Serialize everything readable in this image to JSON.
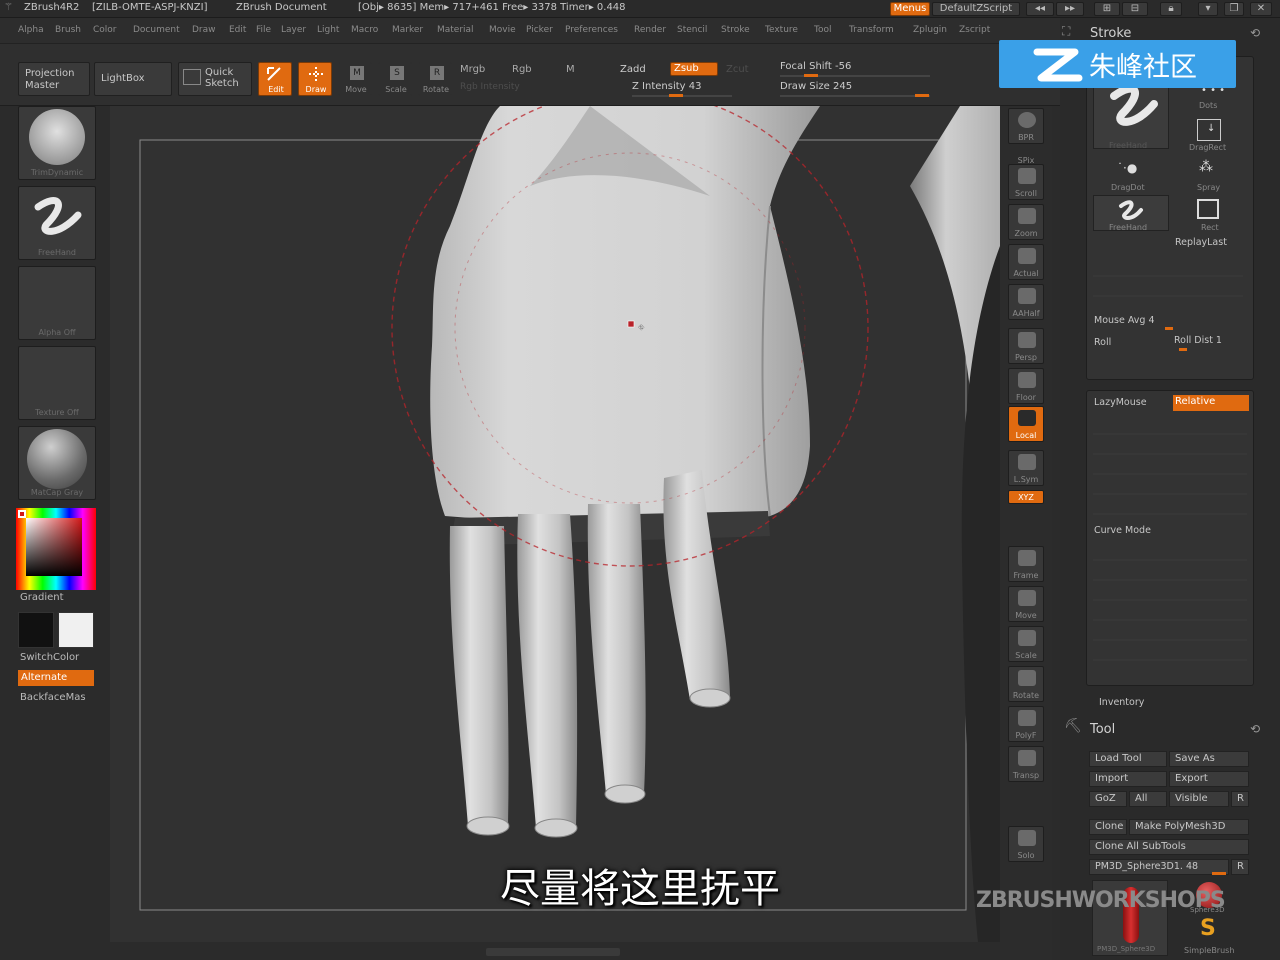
{
  "titlebar": {
    "app": "ZBrush4R2",
    "serial": "[ZILB-OMTE-ASPJ-KNZI]",
    "doc": "ZBrush Document",
    "stats": "[Obj▸ 8635] Mem▸ 717+461  Free▸ 3378  Timer▸ 0.448",
    "menus": "Menus",
    "script": "DefaultZScript"
  },
  "menus": [
    "Alpha",
    "Brush",
    "Color",
    "Document",
    "Draw",
    "Edit",
    "File",
    "Layer",
    "Light",
    "Macro",
    "Marker",
    "Material",
    "Movie",
    "Picker",
    "Preferences",
    "Render",
    "Stencil",
    "Stroke",
    "Texture",
    "Tool",
    "Transform",
    "Zplugin",
    "Zscript"
  ],
  "shelf": {
    "projection_master": "Projection Master",
    "lightbox": "LightBox",
    "quick_sketch": "Quick Sketch",
    "edit": "Edit",
    "draw": "Draw",
    "move": "Move",
    "scale": "Scale",
    "rotate": "Rotate",
    "mrgb": "Mrgb",
    "rgb": "Rgb",
    "m": "M",
    "rgb_intensity": "Rgb Intensity",
    "zadd": "Zadd",
    "zsub": "Zsub",
    "zcut": "Zcut",
    "z_intensity": "Z Intensity 43",
    "focal_shift": "Focal Shift -56",
    "draw_size": "Draw Size 245",
    "z_intensity_fill": 0.43,
    "draw_size_fill": 0.98
  },
  "left": {
    "brush_label": "TrimDynamic",
    "stroke_label": "FreeHand",
    "alpha_label": "Alpha Off",
    "texture_label": "Texture Off",
    "material_label": "MatCap Gray",
    "gradient": "Gradient",
    "switch_color": "SwitchColor",
    "alternate": "Alternate",
    "backface": "BackfaceMas"
  },
  "rightshelf": [
    "BPR",
    "SPix",
    "Scroll",
    "Zoom",
    "Actual",
    "AAHalf",
    "Persp",
    "Floor",
    "Local",
    "L.Sym",
    "XYZ",
    "Frame",
    "Move",
    "Scale",
    "Rotate",
    "PolyF",
    "Transp",
    "Solo"
  ],
  "stroke_panel": {
    "title": "Stroke",
    "dots": "Dots",
    "dragrect": "DragRect",
    "dragdot": "DragDot",
    "spray": "Spray",
    "freehand": "FreeHand",
    "rect": "Rect",
    "freehand_top": "FreeHand",
    "replay_last": "ReplayLast",
    "mouse_avg": "Mouse Avg 4",
    "roll": "Roll",
    "roll_dist": "Roll Dist 1",
    "lazymouse": "LazyMouse",
    "relative": "Relative",
    "curve_mode": "Curve Mode",
    "inventory": "Inventory"
  },
  "tool_panel": {
    "title": "Tool",
    "load_tool": "Load Tool",
    "save_as": "Save As",
    "import": "Import",
    "export": "Export",
    "goz": "GoZ",
    "all": "All",
    "visible": "Visible",
    "r": "R",
    "clone": "Clone",
    "make_polymesh": "Make PolyMesh3D",
    "clone_all": "Clone All SubTools",
    "current_tool": "PM3D_Sphere3D1. 48",
    "thumb1": "PM3D_Sphere3D",
    "thumb2": "SimpleBrush",
    "thumb_sphere": "Sphere3D"
  },
  "logo_text": "朱峰社区",
  "watermark": "ZBRUSHWORKSHOPS",
  "subtitle": "尽量将这里抚平",
  "colors": {
    "accent": "#e06a10",
    "logo_bg": "#3aa0e8",
    "brush_circle": "#b8232a"
  }
}
